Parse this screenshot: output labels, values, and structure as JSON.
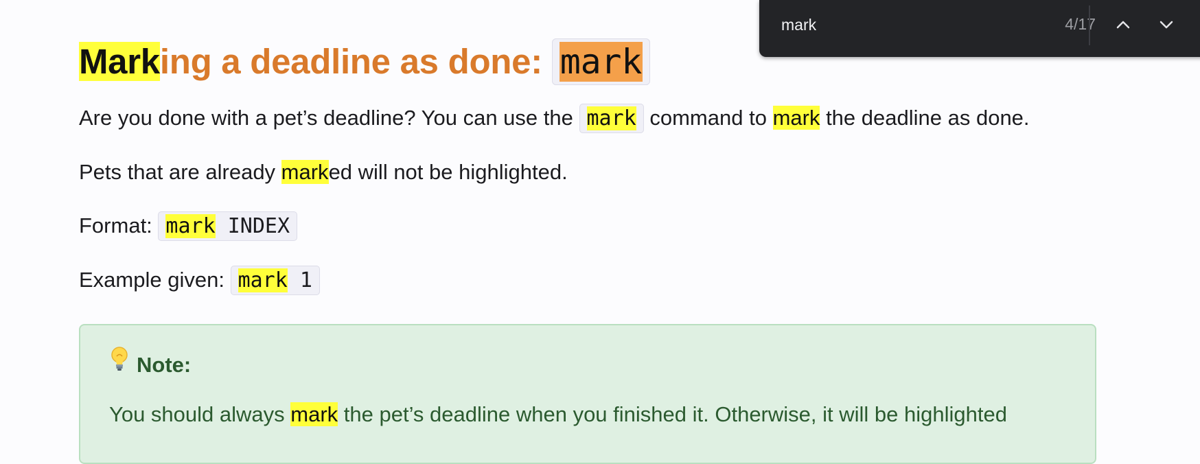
{
  "heading": {
    "prefix_highlight": "Mark",
    "rest": "ing a deadline as done: ",
    "code": "mark"
  },
  "paragraph1": {
    "text1": "Are you done with a pet’s deadline? You can use the ",
    "code": "mark",
    "text2": " command to ",
    "highlight": "mark",
    "text3": " the deadline as done."
  },
  "paragraph2": {
    "text1": "Pets that are already ",
    "highlight": "mark",
    "text2": "ed will not be highlighted."
  },
  "format": {
    "label": "Format: ",
    "code_highlight": "mark",
    "code_rest": " INDEX"
  },
  "example": {
    "label": "Example given: ",
    "code_highlight": "mark",
    "code_rest": " 1"
  },
  "note": {
    "title": "Note:",
    "text1": "You should always ",
    "highlight": "mark",
    "text2": " the pet’s deadline when you finished it. Otherwise, it will be highlighted"
  },
  "find_bar": {
    "query": "mark",
    "count": "4/17"
  },
  "colors": {
    "heading": "#d97a2b",
    "match_highlight": "#ffff3a",
    "current_match": "#f4a04a",
    "note_background": "#dff0e2",
    "note_text": "#2b5a2f",
    "find_bar_background": "#232427"
  },
  "icons": {
    "note": "lightbulb-icon",
    "previous_match": "chevron-up-icon",
    "next_match": "chevron-down-icon"
  }
}
